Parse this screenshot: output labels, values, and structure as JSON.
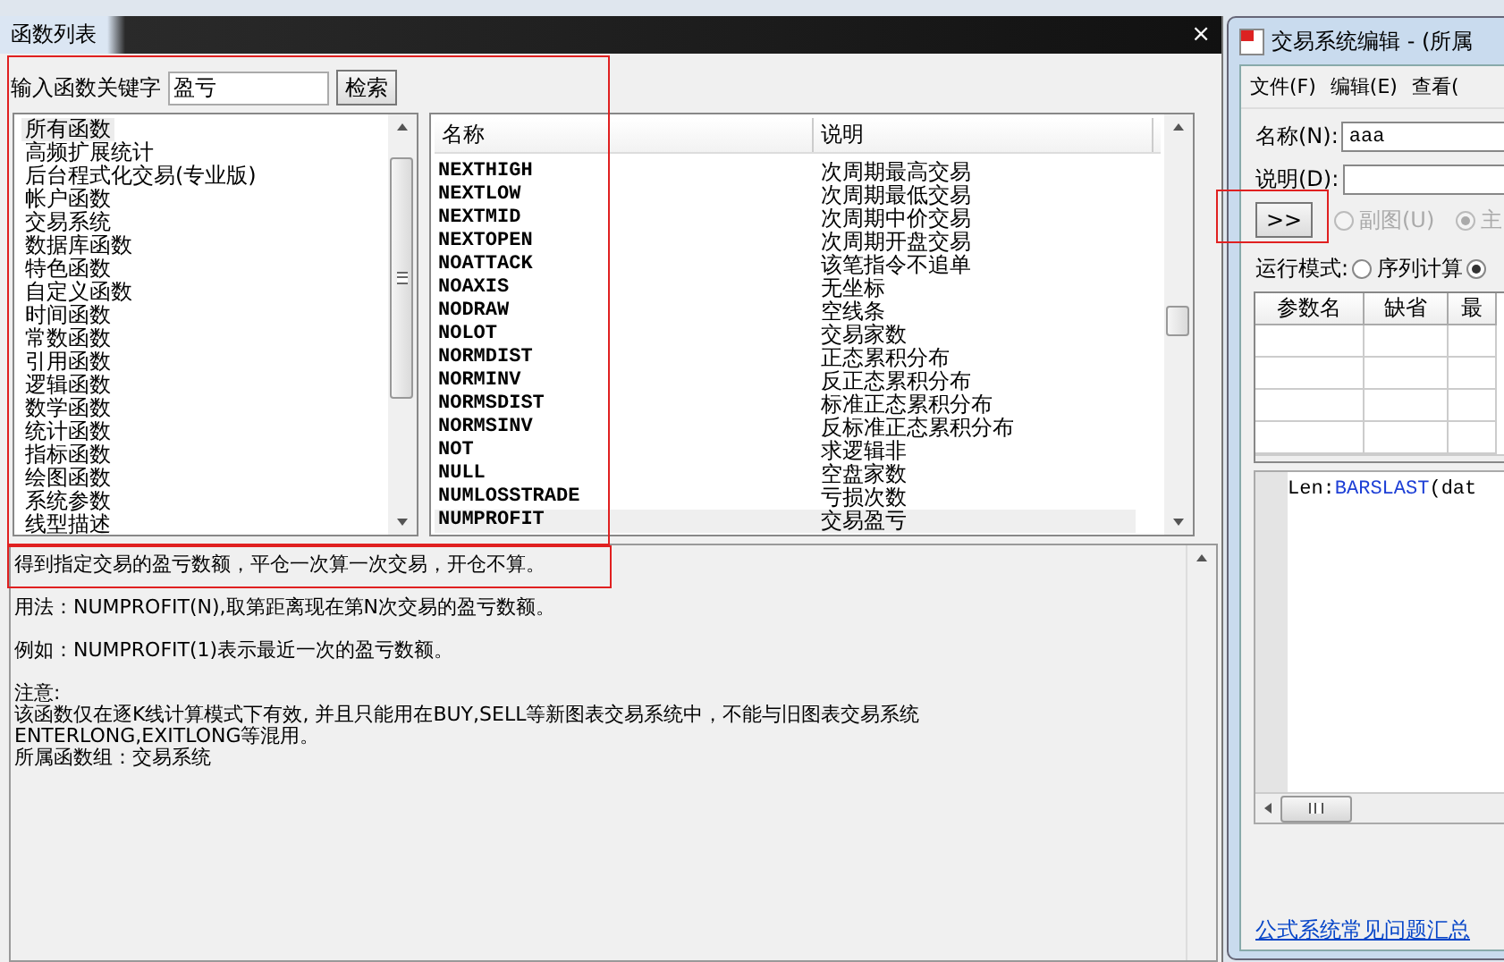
{
  "function_window": {
    "title": "函数列表",
    "close": "×",
    "search": {
      "label": "输入函数关键字",
      "value": "盈亏",
      "button": "检索"
    },
    "categories": [
      {
        "label": "所有函数",
        "selected": true
      },
      {
        "label": "高频扩展统计",
        "selected": false
      },
      {
        "label": "后台程式化交易(专业版)",
        "selected": false
      },
      {
        "label": "帐户函数",
        "selected": false
      },
      {
        "label": "交易系统",
        "selected": false
      },
      {
        "label": "数据库函数",
        "selected": false
      },
      {
        "label": "特色函数",
        "selected": false
      },
      {
        "label": "自定义函数",
        "selected": false
      },
      {
        "label": "时间函数",
        "selected": false
      },
      {
        "label": "常数函数",
        "selected": false
      },
      {
        "label": "引用函数",
        "selected": false
      },
      {
        "label": "逻辑函数",
        "selected": false
      },
      {
        "label": "数学函数",
        "selected": false
      },
      {
        "label": "统计函数",
        "selected": false
      },
      {
        "label": "指标函数",
        "selected": false
      },
      {
        "label": "绘图函数",
        "selected": false
      },
      {
        "label": "系统参数",
        "selected": false
      },
      {
        "label": "线型描述",
        "selected": false
      }
    ],
    "table": {
      "columns": [
        "名称",
        "说明"
      ],
      "rows": [
        {
          "name": "NEXTHIGH",
          "desc": "次周期最高交易",
          "selected": false
        },
        {
          "name": "NEXTLOW",
          "desc": "次周期最低交易",
          "selected": false
        },
        {
          "name": "NEXTMID",
          "desc": "次周期中价交易",
          "selected": false
        },
        {
          "name": "NEXTOPEN",
          "desc": "次周期开盘交易",
          "selected": false
        },
        {
          "name": "NOATTACK",
          "desc": "该笔指令不追单",
          "selected": false
        },
        {
          "name": "NOAXIS",
          "desc": "无坐标",
          "selected": false
        },
        {
          "name": "NODRAW",
          "desc": "空线条",
          "selected": false
        },
        {
          "name": "NOLOT",
          "desc": "交易家数",
          "selected": false
        },
        {
          "name": "NORMDIST",
          "desc": "正态累积分布",
          "selected": false
        },
        {
          "name": "NORMINV",
          "desc": "反正态累积分布",
          "selected": false
        },
        {
          "name": "NORMSDIST",
          "desc": "标准正态累积分布",
          "selected": false
        },
        {
          "name": "NORMSINV",
          "desc": "反标准正态累积分布",
          "selected": false
        },
        {
          "name": "NOT",
          "desc": "求逻辑非",
          "selected": false
        },
        {
          "name": "NULL",
          "desc": "空盘家数",
          "selected": false
        },
        {
          "name": "NUMLOSSTRADE",
          "desc": "亏损次数",
          "selected": false
        },
        {
          "name": "NUMPROFIT",
          "desc": "交易盈亏",
          "selected": true
        }
      ]
    },
    "description": [
      [
        "得到指定交易的盈亏数额，平仓一次算一次交易，开仓不算。"
      ],
      [
        "用法：NUMPROFIT(N),取第距离现在第N次交易的盈亏数额。"
      ],
      [
        "例如：NUMPROFIT(1)表示最近一次的盈亏数额。"
      ],
      [
        "注意:",
        "该函数仅在逐K线计算模式下有效, 并且只能用在BUY,SELL等新图表交易系统中，不能与旧图表交易系统",
        "ENTERLONG,EXITLONG等混用。",
        "所属函数组：交易系统"
      ]
    ]
  },
  "editor_window": {
    "title": "交易系统编辑 - (所属",
    "menu": [
      "文件(F)",
      "编辑(E)",
      "查看("
    ],
    "name_label": "名称(N):",
    "name_value": "aaa",
    "desc_label": "说明(D):",
    "expand_button": ">>",
    "chart_radios": [
      {
        "label": "副图(U)",
        "selected": false,
        "disabled": true
      },
      {
        "label": "主",
        "selected": true,
        "disabled": true
      }
    ],
    "run_mode_label": "运行模式:",
    "run_mode_radios": [
      {
        "label": "序列计算",
        "selected": false
      },
      {
        "selected": true
      }
    ],
    "param_columns": [
      "参数名",
      "缺省",
      "最"
    ],
    "code": [
      {
        "text": "Len:",
        "kind": "plain"
      },
      {
        "text": "BARSLAST",
        "kind": "function"
      },
      {
        "text": "(dat",
        "kind": "plain"
      }
    ],
    "help_link": "公式系统常见问题汇总"
  }
}
